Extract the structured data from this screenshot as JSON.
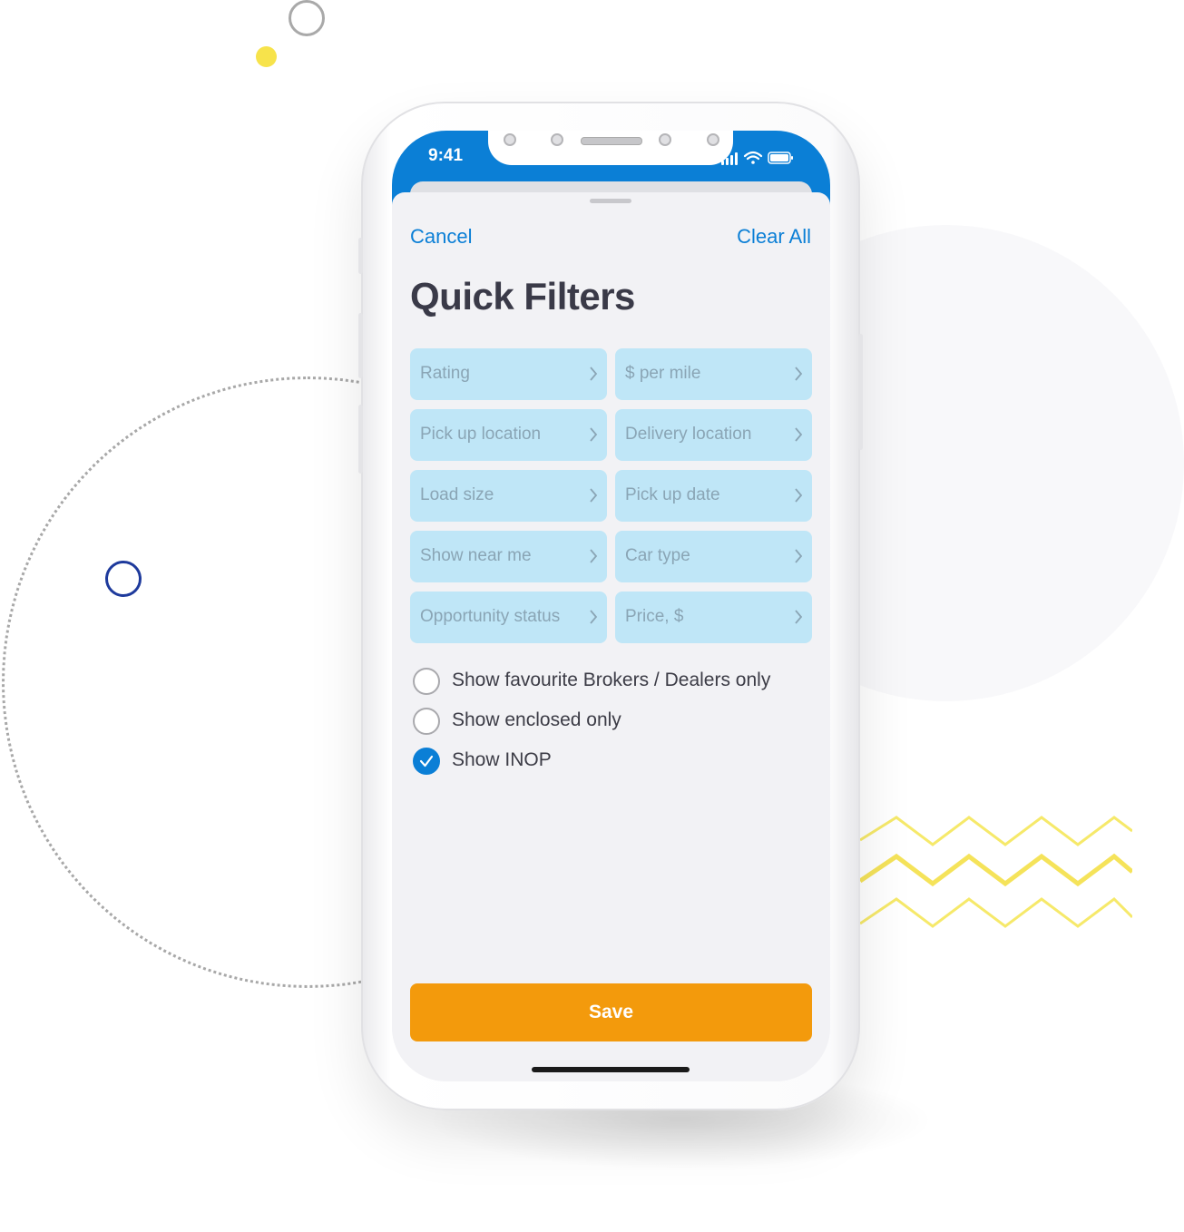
{
  "status_bar": {
    "time": "9:41"
  },
  "header": {
    "cancel_label": "Cancel",
    "clear_all_label": "Clear All"
  },
  "title": "Quick Filters",
  "filters": [
    {
      "label": "Rating"
    },
    {
      "label": "$ per mile"
    },
    {
      "label": "Pick up location"
    },
    {
      "label": "Delivery location"
    },
    {
      "label": "Load size"
    },
    {
      "label": "Pick up date"
    },
    {
      "label": "Show near me"
    },
    {
      "label": "Car type"
    },
    {
      "label": "Opportunity status"
    },
    {
      "label": "Price, $"
    }
  ],
  "options": [
    {
      "label": "Show favourite Brokers / Dealers only",
      "checked": false
    },
    {
      "label": "Show enclosed only",
      "checked": false
    },
    {
      "label": "Show INOP",
      "checked": true
    }
  ],
  "save_label": "Save",
  "colors": {
    "accent": "#0b7fd6",
    "save": "#f39a0c",
    "chip": "#bfe6f7",
    "title": "#3a3a48"
  }
}
